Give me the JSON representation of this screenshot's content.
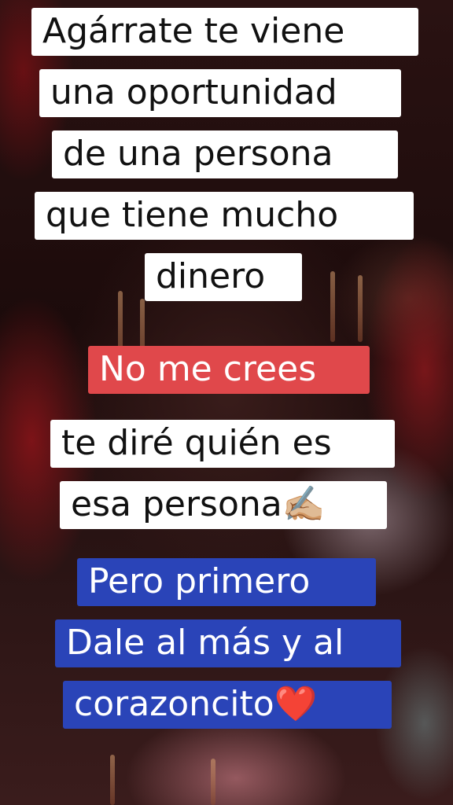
{
  "overlay": {
    "block1": [
      "Agárrate te viene",
      "una oportunidad",
      "de una persona",
      "que tiene mucho",
      "dinero"
    ],
    "block2": [
      "No me crees"
    ],
    "block3": [
      "te diré quién es",
      "esa persona✍🏼"
    ],
    "block4": [
      "Pero primero",
      "Dale al más y al",
      "corazoncito❤️"
    ]
  },
  "colors": {
    "white_box": "#ffffff",
    "red_box": "#e0484b",
    "blue_box": "#2a44b8"
  }
}
